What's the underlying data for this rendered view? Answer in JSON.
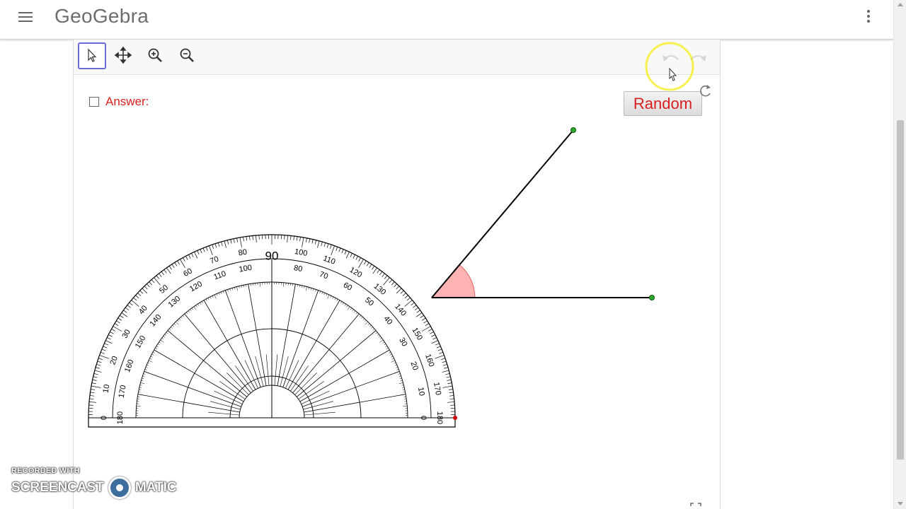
{
  "app": {
    "brand": "GeoGebra"
  },
  "toolbar": {
    "tools": [
      {
        "name": "move",
        "icon": "cursor-arrow-icon"
      },
      {
        "name": "move-graphics-view",
        "icon": "move-arrows-icon"
      },
      {
        "name": "zoom-in",
        "icon": "zoom-in-icon"
      },
      {
        "name": "zoom-out",
        "icon": "zoom-out-icon"
      }
    ],
    "undo_icon": "undo-icon",
    "redo_icon": "redo-icon"
  },
  "applet": {
    "answer_label": "Answer:",
    "answer_checked": false,
    "random_label": "Random",
    "reset_icon": "refresh-icon",
    "fullscreen_icon": "fullscreen-icon"
  },
  "protractor": {
    "center_label": "90",
    "outer_scale": [
      "0",
      "10",
      "20",
      "30",
      "40",
      "50",
      "60",
      "70",
      "80",
      "100",
      "110",
      "120",
      "130",
      "140",
      "150",
      "160",
      "170",
      "180"
    ],
    "inner_scale": [
      "180",
      "170",
      "160",
      "150",
      "140",
      "130",
      "120",
      "110",
      "100",
      "80",
      "70",
      "60",
      "50",
      "40",
      "30",
      "20",
      "10",
      "0"
    ]
  },
  "angle": {
    "fill_color": "#ffb3b3",
    "point_color": "#2ea82e",
    "protractor_point_color": "#cc0000"
  },
  "colors": {
    "answer_red": "#d91e1e",
    "tool_active_border": "#6b6bd8",
    "cursor_highlight": "#f5ef3c"
  },
  "watermark": {
    "line1": "RECORDED WITH",
    "left": "SCREENCAST",
    "right": "MATIC"
  }
}
